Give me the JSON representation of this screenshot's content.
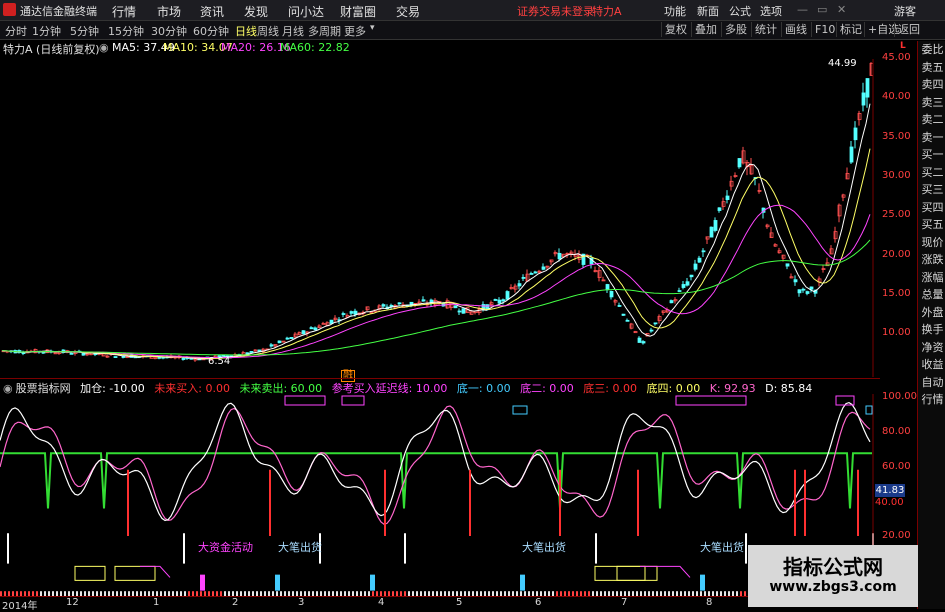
{
  "window": {
    "app_title": "通达信金融终端",
    "menu": [
      "行情",
      "市场",
      "资讯",
      "发现",
      "问小达",
      "财富圈",
      "交易"
    ],
    "trade_status": "证券交易未登录",
    "stock_name": "特力A",
    "right_menu": [
      "功能",
      "新面",
      "公式",
      "选项"
    ],
    "guest": "游客"
  },
  "toolbar": {
    "periods": [
      "分时",
      "1分钟",
      "5分钟",
      "15分钟",
      "30分钟",
      "60分钟",
      "日线",
      "周线",
      "月线",
      "多周期",
      "更多"
    ],
    "active_period": "日线",
    "buttons": [
      "复权",
      "叠加",
      "多股",
      "统计",
      "画线",
      "F10",
      "标记",
      "+自选",
      "返回"
    ]
  },
  "chart_info": {
    "title": "特力A (日线前复权)",
    "ma": [
      {
        "label": "MA5: 37.49",
        "color": "#ffffff"
      },
      {
        "label": "MA10: 34.07",
        "color": "#ffff66"
      },
      {
        "label": "MA20: 26.16",
        "color": "#ff44ff"
      },
      {
        "label": "MA60: 22.82",
        "color": "#44ff44"
      }
    ],
    "low_label": "6.54",
    "high_label": "44.99",
    "event_marker": "融"
  },
  "price_axis": [
    "45.00",
    "40.00",
    "35.00",
    "30.00",
    "25.00",
    "20.00",
    "15.00",
    "10.00"
  ],
  "indicator": {
    "name": "股票指标网",
    "items": [
      {
        "text": "加仓: -10.00",
        "color": "#ffffff"
      },
      {
        "text": "未来买入: 0.00",
        "color": "#ff3030"
      },
      {
        "text": "未来卖出: 60.00",
        "color": "#44ff44"
      },
      {
        "text": "参考买入延迟线: 10.00",
        "color": "#ff44ff"
      },
      {
        "text": "底一: 0.00",
        "color": "#44ccff"
      },
      {
        "text": "底二: 0.00",
        "color": "#ff44ff"
      },
      {
        "text": "底三: 0.00",
        "color": "#ff3030"
      },
      {
        "text": "底四: 0.00",
        "color": "#ffff66"
      },
      {
        "text": "K: 92.93",
        "color": "#ff66cc"
      },
      {
        "text": "D: 85.84",
        "color": "#ffffff"
      }
    ],
    "axis": [
      "100.00",
      "80.00",
      "60.00",
      "40.00",
      "20.00"
    ],
    "current_value": "41.83",
    "annotations": [
      {
        "text": "大资金活动",
        "color": "#ff44ff"
      },
      {
        "text": "大笔出货",
        "color": "#aaddff"
      },
      {
        "text": "大笔出货",
        "color": "#aaddff"
      },
      {
        "text": "大笔出货",
        "color": "#aaddff"
      }
    ]
  },
  "right_panel": [
    "委比",
    "卖五",
    "卖四",
    "卖三",
    "卖二",
    "卖一",
    "买一",
    "买二",
    "买三",
    "买四",
    "买五",
    "现价",
    "涨跌",
    "涨幅",
    "总量",
    "外盘",
    "换手",
    "净资",
    "收益",
    "自动",
    "行情"
  ],
  "date_axis": [
    "2014年",
    "12",
    "1",
    "2",
    "3",
    "4",
    "5",
    "6",
    "7",
    "8"
  ],
  "watermark": {
    "title": "指标公式网",
    "url": "www.zbgs3.com"
  }
}
